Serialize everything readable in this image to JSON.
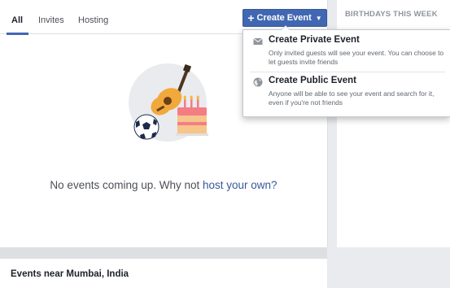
{
  "tabs": [
    {
      "label": "All",
      "active": true
    },
    {
      "label": "Invites",
      "active": false
    },
    {
      "label": "Hosting",
      "active": false
    }
  ],
  "create_button": {
    "label": "Create Event"
  },
  "dropdown": {
    "private": {
      "title": "Create Private Event",
      "description": "Only invited guests will see your event. You can choose to let guests invite friends"
    },
    "public": {
      "title": "Create Public Event",
      "description": "Anyone will be able to see your event and search for it, even if you're not friends"
    }
  },
  "empty_state": {
    "text": "No events coming up. Why not ",
    "link": "host your own?"
  },
  "right_panel": {
    "header": "BIRTHDAYS THIS WEEK"
  },
  "near": {
    "title": "Events near Mumbai, India"
  },
  "colors": {
    "accent": "#4267b2",
    "link": "#365899",
    "background": "#e9ebee"
  },
  "icons": [
    "plus-icon",
    "caret-down-icon",
    "envelope-icon",
    "globe-icon",
    "guitar-icon",
    "soccer-ball-icon",
    "birthday-cake-icon"
  ]
}
